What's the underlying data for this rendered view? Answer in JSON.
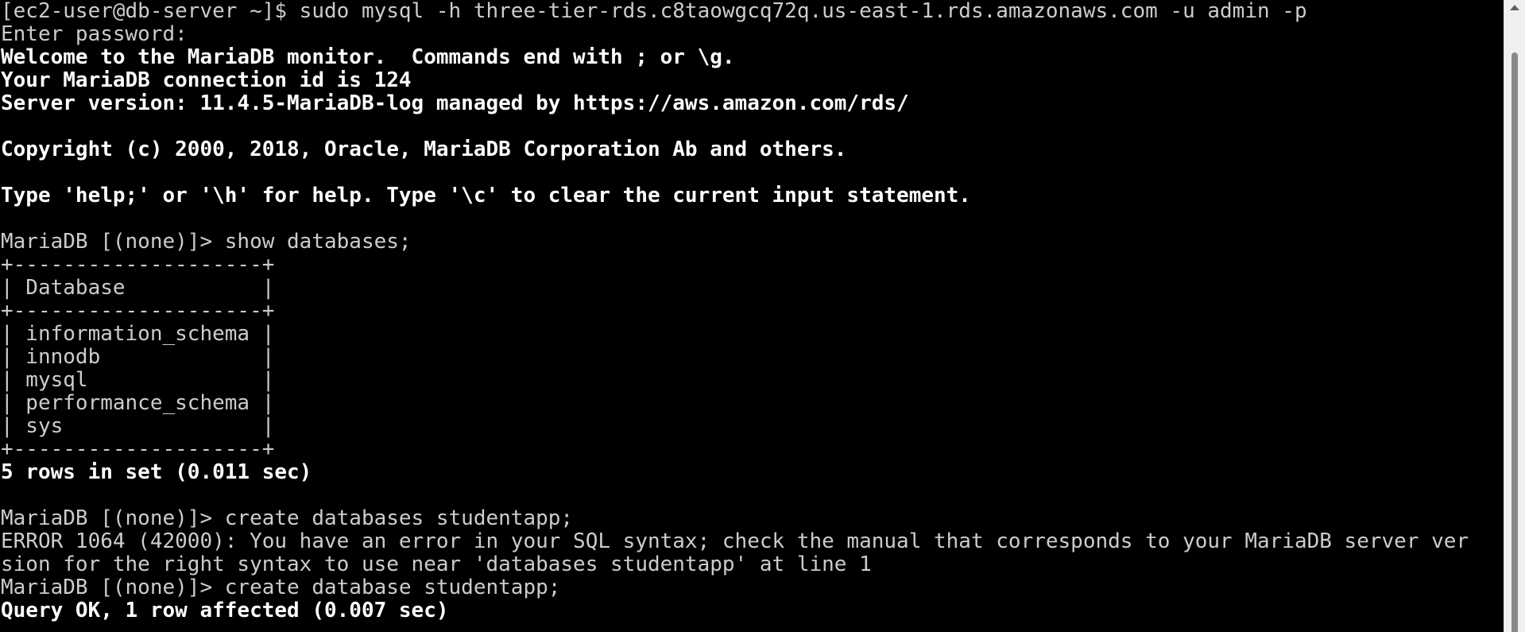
{
  "window": {
    "scrollbar_color": "#8a8a8a",
    "background": "#000000",
    "text_color": "#cccccc",
    "bold_color": "#ffffff"
  },
  "terminal": {
    "lines": [
      {
        "text": "[ec2-user@db-server ~]$ sudo mysql -h three-tier-rds.c8taowgcq72q.us-east-1.rds.amazonaws.com -u admin -p",
        "style": "normal"
      },
      {
        "text": "Enter password:",
        "style": "normal"
      },
      {
        "text": "Welcome to the MariaDB monitor.  Commands end with ; or \\g.",
        "style": "bold"
      },
      {
        "text": "Your MariaDB connection id is 124",
        "style": "bold"
      },
      {
        "text": "Server version: 11.4.5-MariaDB-log managed by https://aws.amazon.com/rds/",
        "style": "bold"
      },
      {
        "text": "",
        "style": "normal"
      },
      {
        "text": "Copyright (c) 2000, 2018, Oracle, MariaDB Corporation Ab and others.",
        "style": "bold"
      },
      {
        "text": "",
        "style": "normal"
      },
      {
        "text": "Type 'help;' or '\\h' for help. Type '\\c' to clear the current input statement.",
        "style": "bold"
      },
      {
        "text": "",
        "style": "normal"
      },
      {
        "text": "MariaDB [(none)]> show databases;",
        "style": "normal"
      },
      {
        "text": "+--------------------+",
        "style": "normal"
      },
      {
        "text": "| Database           |",
        "style": "normal"
      },
      {
        "text": "+--------------------+",
        "style": "normal"
      },
      {
        "text": "| information_schema |",
        "style": "normal"
      },
      {
        "text": "| innodb             |",
        "style": "normal"
      },
      {
        "text": "| mysql              |",
        "style": "normal"
      },
      {
        "text": "| performance_schema |",
        "style": "normal"
      },
      {
        "text": "| sys                |",
        "style": "normal"
      },
      {
        "text": "+--------------------+",
        "style": "normal"
      },
      {
        "text": "5 rows in set (0.011 sec)",
        "style": "bold"
      },
      {
        "text": "",
        "style": "normal"
      },
      {
        "text": "MariaDB [(none)]> create databases studentapp;",
        "style": "normal"
      },
      {
        "text": "ERROR 1064 (42000): You have an error in your SQL syntax; check the manual that corresponds to your MariaDB server ver",
        "style": "normal"
      },
      {
        "text": "sion for the right syntax to use near 'databases studentapp' at line 1",
        "style": "normal"
      },
      {
        "text": "MariaDB [(none)]> create database studentapp;",
        "style": "normal"
      },
      {
        "text": "Query OK, 1 row affected (0.007 sec)",
        "style": "bold"
      }
    ]
  }
}
